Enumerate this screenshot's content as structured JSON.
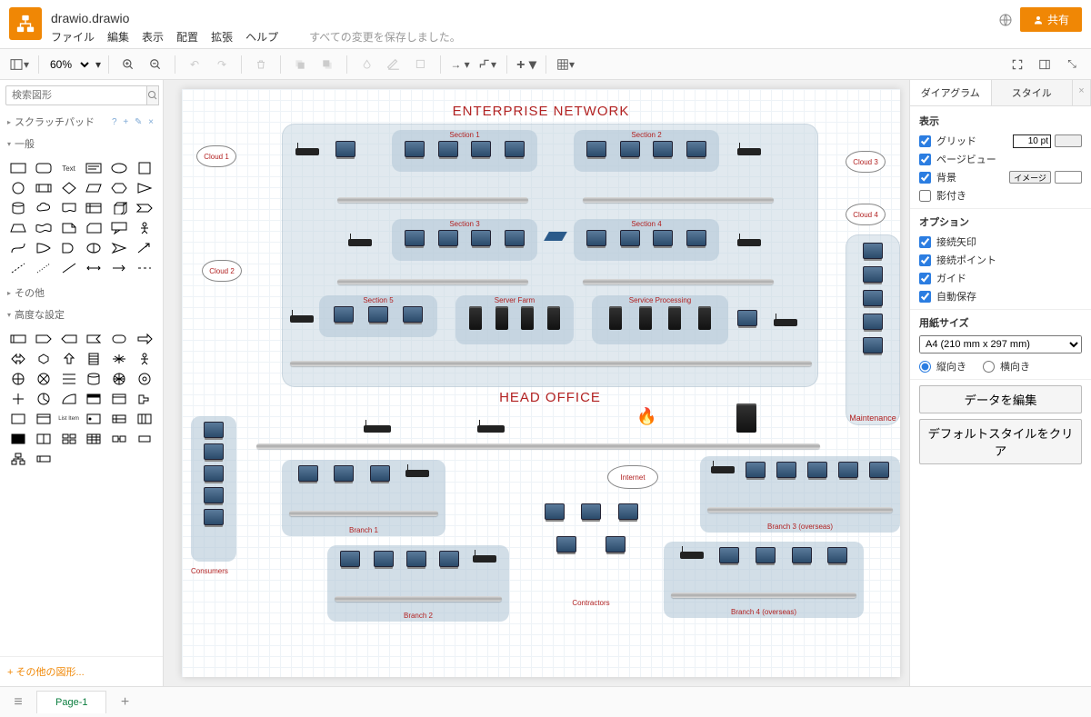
{
  "header": {
    "file_name": "drawio.drawio",
    "menus": [
      "ファイル",
      "編集",
      "表示",
      "配置",
      "拡張",
      "ヘルプ"
    ],
    "save_status": "すべての変更を保存しました。",
    "share_label": "共有"
  },
  "toolbar": {
    "zoom": "60%"
  },
  "left": {
    "search_placeholder": "検索図形",
    "scratchpad": "スクラッチパッド",
    "general": "一般",
    "other": "その他",
    "advanced": "高度な設定",
    "more_shapes": "+ その他の図形..."
  },
  "right": {
    "tab_diagram": "ダイアグラム",
    "tab_style": "スタイル",
    "display_head": "表示",
    "grid": "グリッド",
    "grid_size": "10 pt",
    "pageview": "ページビュー",
    "background": "背景",
    "background_btn": "イメージ",
    "shadow": "影付き",
    "options_head": "オプション",
    "conn_arrows": "接続矢印",
    "conn_points": "接続ポイント",
    "guides": "ガイド",
    "autosave": "自動保存",
    "papersize_head": "用紙サイズ",
    "papersize_value": "A4 (210 mm x 297 mm)",
    "portrait": "縦向き",
    "landscape": "横向き",
    "edit_data": "データを編集",
    "reset_style": "デフォルトスタイルをクリア"
  },
  "pages": {
    "page1": "Page-1"
  },
  "diagram": {
    "title_top": "ENTERPRISE NETWORK",
    "title_mid": "HEAD OFFICE",
    "cloud1": "Cloud 1",
    "cloud2": "Cloud 2",
    "cloud3": "Cloud 3",
    "cloud4": "Cloud 4",
    "section1": "Section 1",
    "section2": "Section 2",
    "section3": "Section 3",
    "section4": "Section 4",
    "section5": "Section 5",
    "serverfarm": "Server Farm",
    "svcproc": "Service Processing",
    "maintenance": "Maintenance",
    "internet": "Internet",
    "consumers": "Consumers",
    "contractors": "Contractors",
    "branch1": "Branch 1",
    "branch2": "Branch 2",
    "branch3": "Branch 3 (overseas)",
    "branch4": "Branch 4 (overseas)"
  }
}
